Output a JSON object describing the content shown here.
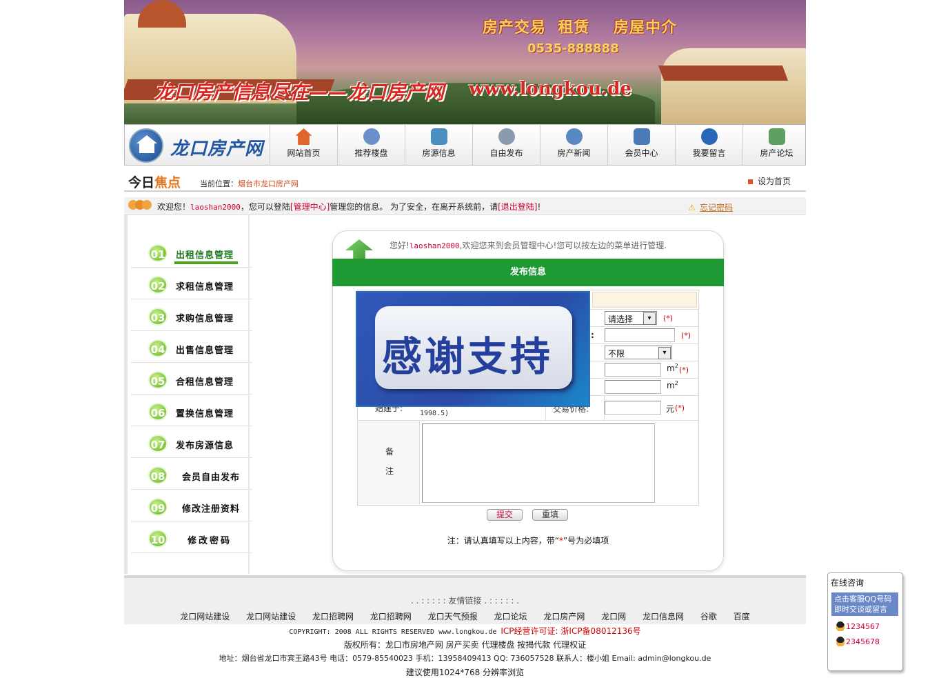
{
  "banner": {
    "services": "房产交易  租赁    房屋中介",
    "phone": "0535-888888",
    "slogan": "龙口房产信息尽在——龙口房产网",
    "url": "www.longkou.de"
  },
  "nav": {
    "logo": "龙口房产网",
    "items": [
      {
        "label": "网站首页",
        "icon": "home-icon",
        "color": "#e2662a"
      },
      {
        "label": "推荐楼盘",
        "icon": "gamepad-icon",
        "color": "#6b8fc9"
      },
      {
        "label": "房源信息",
        "icon": "camera-icon",
        "color": "#4a8fc0"
      },
      {
        "label": "自由发布",
        "icon": "refresh-icon",
        "color": "#8a9bb0"
      },
      {
        "label": "房产新闻",
        "icon": "disc-icon",
        "color": "#5a88c0"
      },
      {
        "label": "会员中心",
        "icon": "computer-icon",
        "color": "#4a7ab8"
      },
      {
        "label": "我要留言",
        "icon": "chat-icon",
        "color": "#2a66b8"
      },
      {
        "label": "房产论坛",
        "icon": "picture-icon",
        "color": "#5ea060"
      }
    ]
  },
  "focus": {
    "title_a": "今日",
    "title_b": "焦点",
    "crumb_label": "当前位置：",
    "crumb_link": "烟台市龙口房产网",
    "sethome": "设为首页"
  },
  "welcome": {
    "a": "欢迎您！",
    "user": "laoshan2000",
    "b": "，您可以登陆",
    "link1": "[管理中心]",
    "c": "管理您的信息。  为了安全，在离开系统前，请",
    "link2": "[退出登陆]",
    "d": "!",
    "forgot": "忘记密码"
  },
  "sidebar": {
    "items": [
      {
        "num": "01",
        "label": "出租信息管理"
      },
      {
        "num": "02",
        "label": "求租信息管理"
      },
      {
        "num": "03",
        "label": "求购信息管理"
      },
      {
        "num": "04",
        "label": "出售信息管理"
      },
      {
        "num": "05",
        "label": "合租信息管理"
      },
      {
        "num": "06",
        "label": "置换信息管理"
      },
      {
        "num": "07",
        "label": "发布房源信息"
      },
      {
        "num": "08",
        "label": "会员自由发布"
      },
      {
        "num": "09",
        "label": "修改注册资料"
      },
      {
        "num": "10",
        "label": "修改密码"
      }
    ]
  },
  "panel": {
    "hello_a": "您好!",
    "user": "laoshan2000",
    "hello_b": ",欢迎您来到会员管理中心!您可以按左边的菜单进行管理.",
    "heading": "发布信息"
  },
  "form": {
    "select1": "请选择",
    "colon": ":",
    "select2": "不限",
    "req": "(*)",
    "unit_m2": "m",
    "sup2": "2",
    "build_label": "始建于:",
    "build_hint": "1998.5)",
    "price_label": "交易价格:",
    "price_unit": "元",
    "remark_1": "备",
    "remark_2": "注",
    "submit": "提交",
    "reset": "重填",
    "note_a": "注：请认真填写以上内容，带“",
    "note_star": "*",
    "note_b": "”号为必填项"
  },
  "overlay": {
    "text": "感谢支持"
  },
  "footer": {
    "links_title": ". . : : : : :  友情链接  . : : : : : .",
    "links": [
      "龙口网站建设",
      "龙口网站建设",
      "龙口招聘网",
      "龙口招聘网",
      "龙口天气预报",
      "龙口论坛",
      "龙口房产网",
      "龙口网",
      "龙口信息网",
      "谷歌",
      "百度"
    ],
    "copy_a": "COPYRIGHT: 2008 ALL RIGHTS RESERVED www.longkou.de ",
    "copy_icp": "ICP经营许可证: 浙ICP备08012136号",
    "rights": "版权所有：龙口市房地产网 房产买卖 代理楼盘 按揭代款 代理权证",
    "address": "地址：烟台省龙口市宾王路43号 电话：0579-85540023 手机：13958409413 QQ: 736057528 联系人：楼小姐 Email: admin@longkou.de",
    "browse": "建议使用1024*768 分辨率浏览"
  },
  "chat": {
    "title": "在线咨询",
    "box_1": "点击客服QQ号码",
    "box_2": "即时交谈或留言",
    "qq1": "1234567",
    "qq2": "2345678"
  }
}
